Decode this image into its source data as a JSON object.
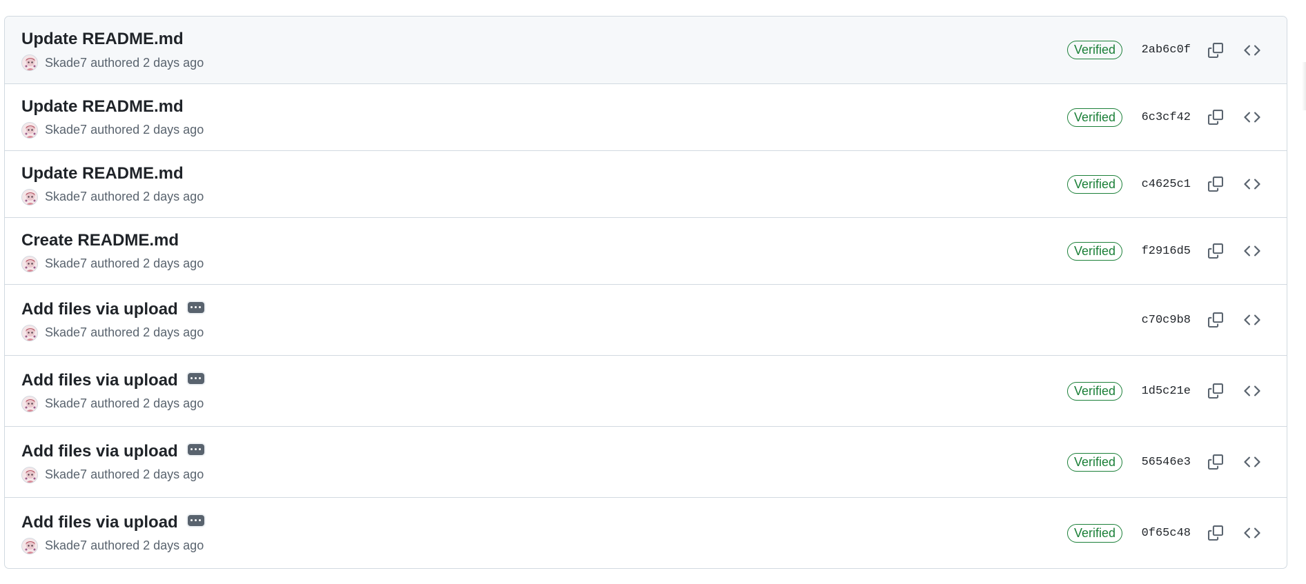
{
  "commits": [
    {
      "title": "Update README.md",
      "author": "Skade7",
      "authored_text": "authored 2 days ago",
      "verified": "Verified",
      "sha": "2ab6c0f",
      "has_ellipsis": false
    },
    {
      "title": "Update README.md",
      "author": "Skade7",
      "authored_text": "authored 2 days ago",
      "verified": "Verified",
      "sha": "6c3cf42",
      "has_ellipsis": false
    },
    {
      "title": "Update README.md",
      "author": "Skade7",
      "authored_text": "authored 2 days ago",
      "verified": "Verified",
      "sha": "c4625c1",
      "has_ellipsis": false
    },
    {
      "title": "Create README.md",
      "author": "Skade7",
      "authored_text": "authored 2 days ago",
      "verified": "Verified",
      "sha": "f2916d5",
      "has_ellipsis": false
    },
    {
      "title": "Add files via upload",
      "author": "Skade7",
      "authored_text": "authored 2 days ago",
      "verified": "",
      "sha": "c70c9b8",
      "has_ellipsis": true
    },
    {
      "title": "Add files via upload",
      "author": "Skade7",
      "authored_text": "authored 2 days ago",
      "verified": "Verified",
      "sha": "1d5c21e",
      "has_ellipsis": true
    },
    {
      "title": "Add files via upload",
      "author": "Skade7",
      "authored_text": "authored 2 days ago",
      "verified": "Verified",
      "sha": "56546e3",
      "has_ellipsis": true
    },
    {
      "title": "Add files via upload",
      "author": "Skade7",
      "authored_text": "authored 2 days ago",
      "verified": "Verified",
      "sha": "0f65c48",
      "has_ellipsis": true
    }
  ],
  "colors": {
    "verified": "#1a7f37",
    "border": "#d1d9e0",
    "highlight_row": "#f6f8fa",
    "muted_text": "#59636e"
  },
  "icons": {
    "copy": "copy-icon",
    "browse": "code-icon",
    "ellipsis": "kebab-horizontal-icon"
  }
}
